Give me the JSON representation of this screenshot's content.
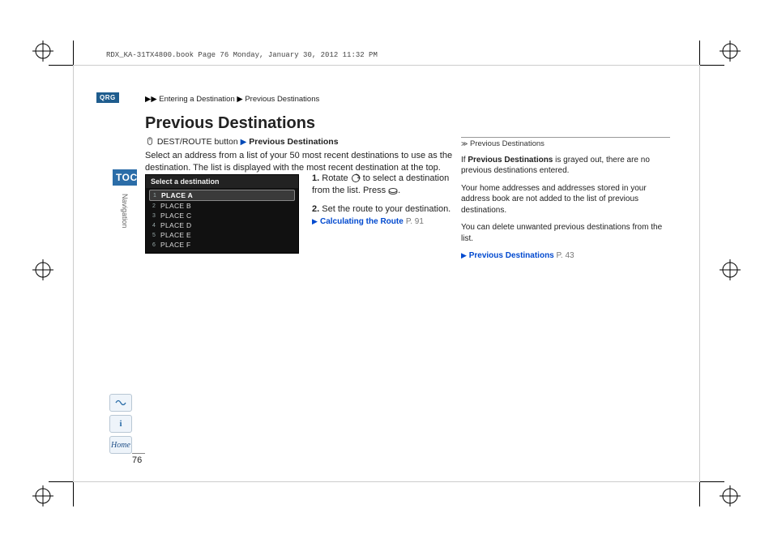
{
  "fileHeader": "RDX_KA-31TX4800.book  Page 76  Monday, January 30, 2012  11:32 PM",
  "breadcrumb": {
    "a": "Entering a Destination",
    "b": "Previous Destinations"
  },
  "qrg": "QRG",
  "title": "Previous Destinations",
  "subhead": {
    "pre": "DEST/ROUTE button",
    "post": "Previous Destinations"
  },
  "intro": "Select an address from a list of your 50 most recent destinations to use as the destination. The list is displayed with the most recent destination at the top.",
  "toc": "TOC",
  "railSection": "Navigation",
  "screenshot": {
    "title": "Select a destination",
    "rows": [
      {
        "n": "1",
        "label": "PLACE A",
        "selected": true
      },
      {
        "n": "2",
        "label": "PLACE B",
        "selected": false
      },
      {
        "n": "3",
        "label": "PLACE C",
        "selected": false
      },
      {
        "n": "4",
        "label": "PLACE D",
        "selected": false
      },
      {
        "n": "5",
        "label": "PLACE E",
        "selected": false
      },
      {
        "n": "6",
        "label": "PLACE F",
        "selected": false
      }
    ]
  },
  "steps": {
    "s1a": "1.",
    "s1b": "Rotate",
    "s1c": "to select a destination from the list. Press",
    "s1d": ".",
    "s2a": "2.",
    "s2b": "Set the route to your destination.",
    "link1": "Calculating the Route",
    "link1page": "P. 91"
  },
  "side": {
    "title": "Previous Destinations",
    "p1a": "If ",
    "p1b": "Previous Destinations",
    "p1c": " is grayed out, there are no previous destinations entered.",
    "p2": "Your home addresses and addresses stored in your address book are not added to the list of previous destinations.",
    "p3": "You can delete unwanted previous destinations from the list.",
    "link": "Previous Destinations",
    "linkpage": "P. 43"
  },
  "footer": {
    "home": "Home"
  },
  "pageNumber": "76"
}
